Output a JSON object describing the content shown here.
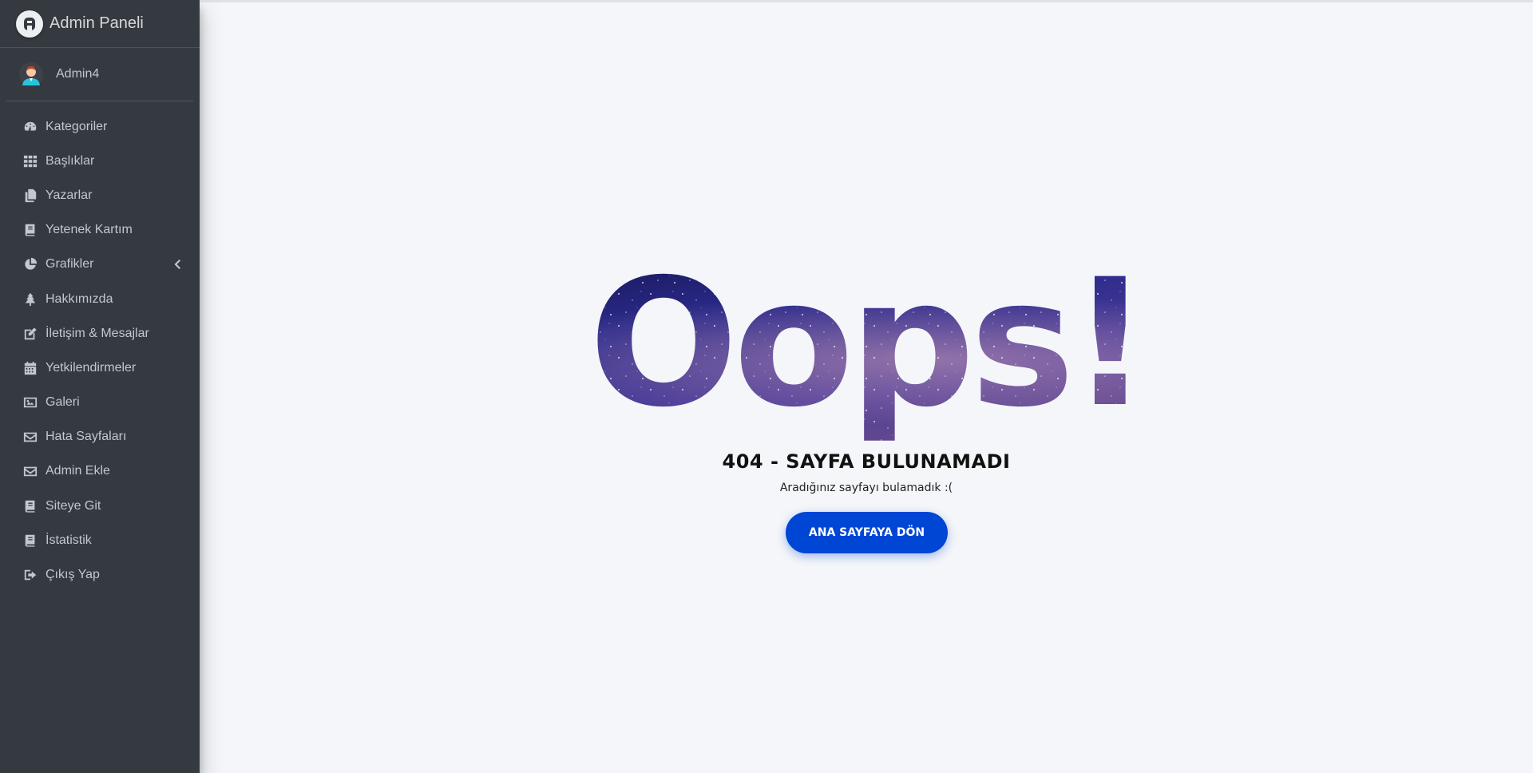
{
  "brand": {
    "title": "Admin Paneli",
    "logo_letter": "A"
  },
  "user": {
    "name": "Admin4"
  },
  "sidebar": {
    "items": [
      {
        "label": "Kategoriler",
        "icon": "tachometer-icon"
      },
      {
        "label": "Başlıklar",
        "icon": "grid-icon"
      },
      {
        "label": "Yazarlar",
        "icon": "copy-icon"
      },
      {
        "label": "Yetenek Kartım",
        "icon": "book-icon"
      },
      {
        "label": "Grafikler",
        "icon": "chart-pie-icon",
        "has_submenu": true
      },
      {
        "label": "Hakkımızda",
        "icon": "tree-icon"
      },
      {
        "label": "İletişim & Mesajlar",
        "icon": "edit-icon"
      },
      {
        "label": "Yetkilendirmeler",
        "icon": "calendar-icon"
      },
      {
        "label": "Galeri",
        "icon": "image-icon"
      },
      {
        "label": "Hata Sayfaları",
        "icon": "envelope-icon"
      },
      {
        "label": "Admin Ekle",
        "icon": "envelope-icon"
      },
      {
        "label": "Siteye Git",
        "icon": "book-icon"
      },
      {
        "label": "İstatistik",
        "icon": "book-icon"
      },
      {
        "label": "Çıkış Yap",
        "icon": "sign-out-icon"
      }
    ]
  },
  "error": {
    "headline": "Oops!",
    "code_title": "404 - SAYFA BULUNAMADI",
    "message": "Aradığınız sayfayı bulamadık :(",
    "button_label": "ANA SAYFAYA DÖN"
  },
  "colors": {
    "sidebar_bg": "#343a40",
    "page_bg": "#f4f6f9",
    "button_bg": "#0046d5",
    "nav_text": "#c2c7d0"
  }
}
